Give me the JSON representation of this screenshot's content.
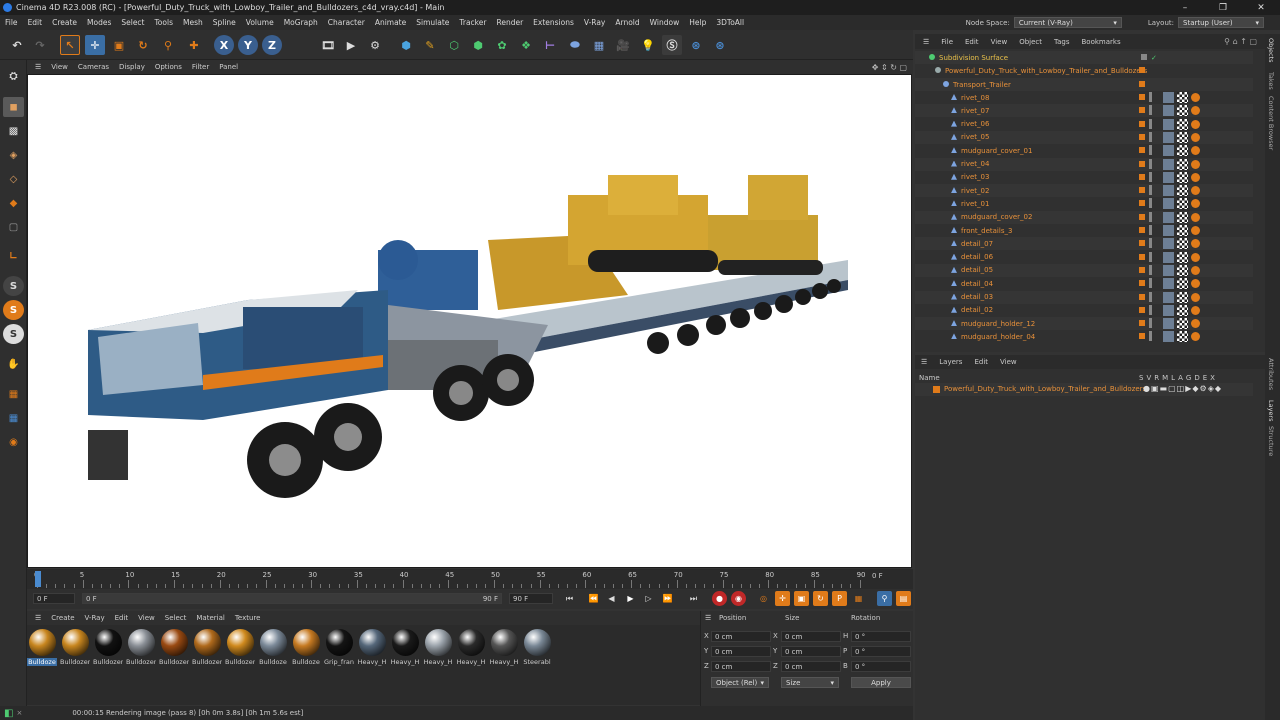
{
  "window": {
    "title": "Cinema 4D R23.008 (RC) - [Powerful_Duty_Truck_with_Lowboy_Trailer_and_Bulldozers_c4d_vray.c4d] - Main",
    "controls": [
      "–",
      "❐",
      "✕"
    ]
  },
  "menubar": {
    "items": [
      "File",
      "Edit",
      "Create",
      "Modes",
      "Select",
      "Tools",
      "Mesh",
      "Spline",
      "Volume",
      "MoGraph",
      "Character",
      "Animate",
      "Simulate",
      "Tracker",
      "Render",
      "Extensions",
      "V-Ray",
      "Arnold",
      "Window",
      "Help",
      "3DToAll"
    ],
    "node_space_label": "Node Space:",
    "node_space_value": "Current (V-Ray)",
    "layout_label": "Layout:",
    "layout_value": "Startup (User)"
  },
  "viewport_menu": [
    "View",
    "Cameras",
    "Display",
    "Options",
    "Filter",
    "Panel"
  ],
  "timeline": {
    "ticks": [
      "0",
      "5",
      "10",
      "15",
      "20",
      "25",
      "30",
      "35",
      "40",
      "45",
      "50",
      "55",
      "60",
      "65",
      "70",
      "75",
      "80",
      "85",
      "90"
    ],
    "current_frame": "0 F"
  },
  "playbar": {
    "start": "0 F",
    "range_start": "0 F",
    "range_end": "90 F",
    "end": "90 F"
  },
  "material_menu": [
    "Create",
    "V-Ray",
    "Edit",
    "View",
    "Select",
    "Material",
    "Texture"
  ],
  "materials": [
    {
      "label": "Bulldoze",
      "color": "#c8861f"
    },
    {
      "label": "Bulldozer",
      "color": "#c8861f"
    },
    {
      "label": "Bulldozer",
      "color": "#111111"
    },
    {
      "label": "Bulldozer",
      "color": "#8a8f96"
    },
    {
      "label": "Bulldozer",
      "color": "#9a4a12"
    },
    {
      "label": "Bulldozer",
      "color": "#b06a1c"
    },
    {
      "label": "Bulldozer",
      "color": "#d08a1e"
    },
    {
      "label": "Bulldoze",
      "color": "#7c8a99"
    },
    {
      "label": "Bulldoze",
      "color": "#c67a22"
    },
    {
      "label": "Grip_fran",
      "color": "#141414"
    },
    {
      "label": "Heavy_H",
      "color": "#55677a"
    },
    {
      "label": "Heavy_H",
      "color": "#1a1a1a"
    },
    {
      "label": "Heavy_H",
      "color": "#9ba3ab"
    },
    {
      "label": "Heavy_H",
      "color": "#2a2a2a"
    },
    {
      "label": "Heavy_H",
      "color": "#555555"
    },
    {
      "label": "Steerabl",
      "color": "#7a8896"
    }
  ],
  "coords": {
    "headers": [
      "Position",
      "Size",
      "Rotation"
    ],
    "rows": [
      {
        "a": "X",
        "pos": "0 cm",
        "b": "X",
        "size": "0 cm",
        "c": "H",
        "rot": "0 °"
      },
      {
        "a": "Y",
        "pos": "0 cm",
        "b": "Y",
        "size": "0 cm",
        "c": "P",
        "rot": "0 °"
      },
      {
        "a": "Z",
        "pos": "0 cm",
        "b": "Z",
        "size": "0 cm",
        "c": "B",
        "rot": "0 °"
      }
    ],
    "mode": "Object (Rel)",
    "size_mode": "Size",
    "apply": "Apply"
  },
  "status": "00:00:15 Rendering image (pass 8) [0h  0m  3.8s] [0h  1m  5.6s est]",
  "object_manager": {
    "menu": [
      "File",
      "Edit",
      "View",
      "Object",
      "Tags",
      "Bookmarks"
    ],
    "root": "Subdivision Surface",
    "group": "Powerful_Duty_Truck_with_Lowboy_Trailer_and_Bulldozers",
    "sub": "Transport_Trailer",
    "items": [
      "rivet_08",
      "rivet_07",
      "rivet_06",
      "rivet_05",
      "mudguard_cover_01",
      "rivet_04",
      "rivet_03",
      "rivet_02",
      "rivet_01",
      "mudguard_cover_02",
      "front_details_3",
      "detail_07",
      "detail_06",
      "detail_05",
      "detail_04",
      "detail_03",
      "detail_02",
      "mudguard_holder_12",
      "mudguard_holder_04"
    ]
  },
  "layer_manager": {
    "menu": [
      "Layers",
      "Edit",
      "View"
    ],
    "col_name": "Name",
    "cols": [
      "S",
      "V",
      "R",
      "M",
      "L",
      "A",
      "G",
      "D",
      "E",
      "X"
    ],
    "layer_name": "Powerful_Duty_Truck_with_Lowboy_Trailer_and_Bulldozers"
  },
  "side_tabs": [
    "Objects",
    "Takes",
    "Content Browser",
    "Attributes",
    "Layers",
    "Structure"
  ]
}
